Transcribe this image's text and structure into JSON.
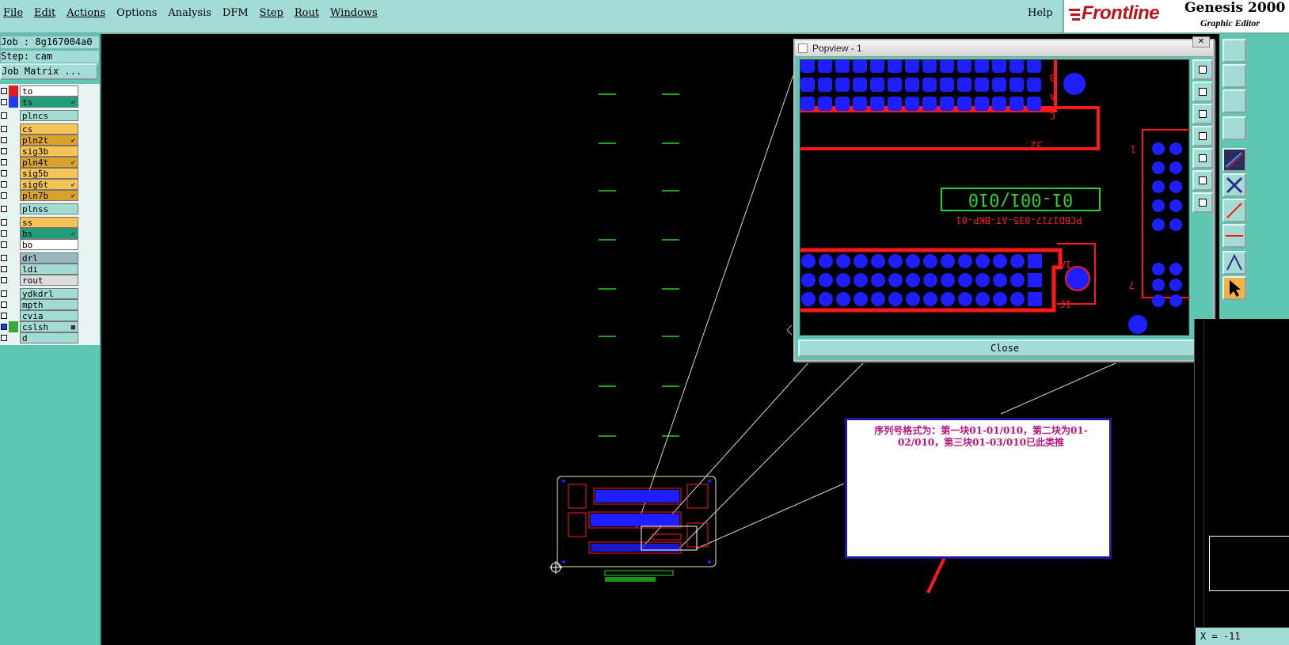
{
  "menu": {
    "items": [
      "File",
      "Edit",
      "Actions",
      "Options",
      "Analysis",
      "DFM",
      "Step",
      "Rout",
      "Windows"
    ],
    "help": "Help"
  },
  "brand": {
    "name": "Frontline",
    "product": "Genesis 2000",
    "subtitle": "Graphic Editor"
  },
  "job": {
    "job_line": "Job : 8g167004a0",
    "step_line": "Step: cam",
    "matrix_button": "Job Matrix ..."
  },
  "layers": [
    {
      "name": "to",
      "swatch": "#e01e1e",
      "bg": "#ffffff",
      "mark": ""
    },
    {
      "name": "ts",
      "swatch": "#1e3cff",
      "bg": "#1e9f7a",
      "mark": "✔"
    },
    {
      "name": "plncs",
      "swatch": "",
      "bg": "#a2dcd4",
      "mark": ""
    },
    {
      "name": "cs",
      "swatch": "",
      "bg": "#f6c455",
      "mark": ""
    },
    {
      "name": "pln2t",
      "swatch": "",
      "bg": "#d9a22a",
      "mark": "✔"
    },
    {
      "name": "sig3b",
      "swatch": "",
      "bg": "#f6c455",
      "mark": ""
    },
    {
      "name": "pln4t",
      "swatch": "",
      "bg": "#d9a22a",
      "mark": "✔"
    },
    {
      "name": "sig5b",
      "swatch": "",
      "bg": "#f6c455",
      "mark": ""
    },
    {
      "name": "sig6t",
      "swatch": "",
      "bg": "#f6c455",
      "mark": "✔"
    },
    {
      "name": "pln7b",
      "swatch": "",
      "bg": "#d9a22a",
      "mark": "✔"
    },
    {
      "name": "plnss",
      "swatch": "",
      "bg": "#a2dcd4",
      "mark": ""
    },
    {
      "name": "ss",
      "swatch": "",
      "bg": "#f6c455",
      "mark": ""
    },
    {
      "name": "bs",
      "swatch": "",
      "bg": "#1e9f7a",
      "mark": "✔"
    },
    {
      "name": "bo",
      "swatch": "",
      "bg": "#ffffff",
      "mark": ""
    },
    {
      "name": "drl",
      "swatch": "",
      "bg": "#9ab7c0",
      "mark": ""
    },
    {
      "name": "ldi",
      "swatch": "",
      "bg": "#a2dcd4",
      "mark": ""
    },
    {
      "name": "rout",
      "swatch": "",
      "bg": "#dcdcdc",
      "mark": ""
    },
    {
      "name": "ydkdrl",
      "swatch": "",
      "bg": "#a2dcd4",
      "mark": ""
    },
    {
      "name": "mpth",
      "swatch": "",
      "bg": "#a2dcd4",
      "mark": ""
    },
    {
      "name": "cvia",
      "swatch": "",
      "bg": "#a2dcd4",
      "mark": ""
    },
    {
      "name": "cslsh",
      "swatch": "#3aa832",
      "bg": "#a2dcd4",
      "mark": "■"
    },
    {
      "name": "d",
      "swatch": "",
      "bg": "#a2dcd4",
      "mark": ""
    }
  ],
  "popview": {
    "title": "Popview - 1",
    "close": "Close",
    "window_close": "✕",
    "serial_label": "01-001/010",
    "part_label": "PCBD1717-035-AT-BKP-01",
    "pin_labels": [
      "32",
      "1",
      "7",
      "1A",
      "1C",
      "A",
      "B",
      "C"
    ]
  },
  "note": {
    "text": "序列号格式为：第一块01-01/010，第二块为01-02/010，第三块01-03/010已此类推"
  },
  "status": {
    "coords": "X = -11"
  },
  "colors": {
    "panel": "#a2dcd4",
    "teal": "#5fc6b2",
    "trace": "#ff1818",
    "pad": "#1e1eff",
    "silk": "#2ad22a",
    "note_border": "#1a1aa0",
    "note_text": "#c0147e"
  },
  "icons": [
    "frontline-logo-icon",
    "popview-window-icon",
    "zoom-icon",
    "pan-icon",
    "fit-icon",
    "select-icon",
    "measure-icon"
  ]
}
